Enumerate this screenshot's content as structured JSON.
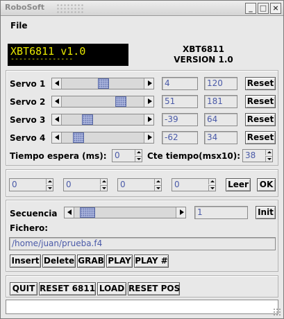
{
  "window": {
    "title": "RoboSoft",
    "btn_min": "_",
    "btn_max": "□",
    "btn_close": "×"
  },
  "menu": {
    "file": "File"
  },
  "header": {
    "lcd_line1": "XBT6811 v1.0",
    "lcd_line2": "---------------",
    "title1": "XBT6811",
    "title2": "VERSION 1.0"
  },
  "colors": {
    "lcd_bg": "#000000",
    "lcd_text": "#e8e800",
    "field_text": "#4a5aa8",
    "thumb": "#a9b3dc"
  },
  "servos": [
    {
      "label": "Servo 1",
      "value": "4",
      "raw": "120",
      "reset": "Reset"
    },
    {
      "label": "Servo 2",
      "value": "51",
      "raw": "181",
      "reset": "Reset"
    },
    {
      "label": "Servo 3",
      "value": "-39",
      "raw": "64",
      "reset": "Reset"
    },
    {
      "label": "Servo 4",
      "value": "-62",
      "raw": "34",
      "reset": "Reset"
    }
  ],
  "timing": {
    "wait_label": "Tiempo espera (ms):",
    "wait_value": "0",
    "cte_label": "Cte tiempo(msx10):",
    "cte_value": "38"
  },
  "readings": {
    "values": [
      "0",
      "0",
      "0",
      "0"
    ],
    "read_button": "Leer",
    "ok_button": "OK"
  },
  "sequence": {
    "label": "Secuencia",
    "value": "1",
    "init_button": "Init",
    "file_label": "Fichero:",
    "file_path": "/home/juan/prueba.f4"
  },
  "seq_buttons": [
    "Insert",
    "Delete",
    "GRAB",
    "PLAY",
    "PLAY #"
  ],
  "bottom_buttons": [
    "QUIT",
    "RESET 6811",
    "LOAD",
    "RESET POS"
  ],
  "status_text": ""
}
